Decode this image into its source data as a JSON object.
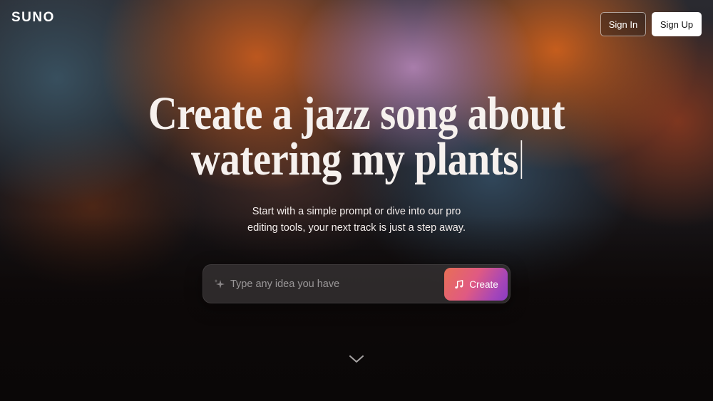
{
  "header": {
    "logo": "SUNO",
    "sign_in_label": "Sign In",
    "sign_up_label": "Sign Up"
  },
  "hero": {
    "headline_line1": "Create a jazz song about",
    "headline_line2": "watering my plants",
    "subtitle_line1": "Start with a simple prompt or dive into our pro",
    "subtitle_line2": "editing tools, your next track is just a step away."
  },
  "prompt": {
    "placeholder": "Type any idea you have",
    "value": "",
    "create_label": "Create"
  },
  "icons": {
    "sparkle": "sparkle-icon",
    "music": "music-note-icon",
    "scroll": "chevron-down-icon"
  },
  "colors": {
    "accent_gradient_start": "#e86f56",
    "accent_gradient_mid": "#e05a82",
    "accent_gradient_end": "#8a3cc2",
    "text": "#ffffff"
  }
}
